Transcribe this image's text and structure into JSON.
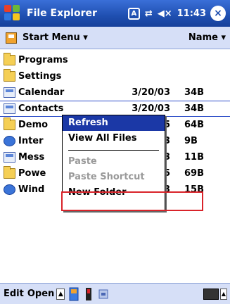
{
  "titlebar": {
    "title": "File Explorer",
    "status_badge": "A",
    "time": "11:43",
    "close_label": "×"
  },
  "location": {
    "path": "Start Menu ▾",
    "sort": "Name ▾"
  },
  "files": [
    {
      "name": "Programs",
      "date": "",
      "size": "",
      "icon": "folder-icon"
    },
    {
      "name": "Settings",
      "date": "",
      "size": "",
      "icon": "folder-icon"
    },
    {
      "name": "Calendar",
      "date": "3/20/03",
      "size": "34B",
      "icon": "calendar-icon"
    },
    {
      "name": "Contacts",
      "date": "3/20/03",
      "size": "34B",
      "icon": "contacts-icon"
    },
    {
      "name": "Demo",
      "date": "5",
      "size": "64B",
      "icon": "app-folder-icon"
    },
    {
      "name": "Inter",
      "date": "3",
      "size": "9B",
      "icon": "internet-explorer-icon"
    },
    {
      "name": "Mess",
      "date": "3",
      "size": "11B",
      "icon": "messaging-icon"
    },
    {
      "name": "Powe",
      "date": "5",
      "size": "69B",
      "icon": "app-folder-icon"
    },
    {
      "name": "Wind",
      "date": "3",
      "size": "15B",
      "icon": "windows-media-icon"
    }
  ],
  "context_menu": {
    "items": [
      "Refresh",
      "View All Files",
      "Paste",
      "Paste Shortcut",
      "New Folder"
    ]
  },
  "bottombar": {
    "edit": "Edit",
    "open": "Open"
  }
}
